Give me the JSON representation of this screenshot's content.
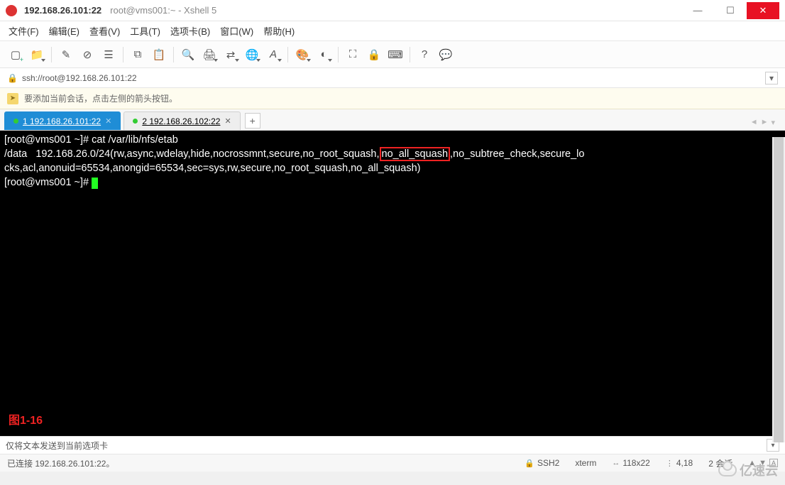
{
  "titlebar": {
    "main": "192.168.26.101:22",
    "sub": "root@vms001:~ - Xshell 5"
  },
  "menu": {
    "file": "文件(F)",
    "edit": "编辑(E)",
    "view": "查看(V)",
    "tools": "工具(T)",
    "tabs": "选项卡(B)",
    "window": "窗口(W)",
    "help": "帮助(H)"
  },
  "address": {
    "url": "ssh://root@192.168.26.101:22"
  },
  "infobar": {
    "text": "要添加当前会话，点击左侧的箭头按钮。"
  },
  "tabs": {
    "t1": {
      "label": "1 192.168.26.101:22"
    },
    "t2": {
      "label": "2 192.168.26.102:22"
    }
  },
  "terminal": {
    "line1": "[root@vms001 ~]# cat /var/lib/nfs/etab",
    "line2a": "/data   192.168.26.0/24(rw,async,wdelay,hide,nocrossmnt,secure,no_root_squash,",
    "line2_hl": "no_all_squash",
    "line2b": ",no_subtree_check,secure_lo",
    "line3": "cks,acl,anonuid=65534,anongid=65534,sec=sys,rw,secure,no_root_squash,no_all_squash)",
    "line4": "[root@vms001 ~]# ",
    "figlabel": "图1-16"
  },
  "destbar": {
    "text": "仅将文本发送到当前选项卡"
  },
  "status": {
    "conn": "已连接 192.168.26.101:22。",
    "proto": "SSH2",
    "term": "xterm",
    "size": "118x22",
    "pos": "4,18",
    "sessions": "2 会话"
  },
  "watermark": {
    "text": "亿速云"
  }
}
